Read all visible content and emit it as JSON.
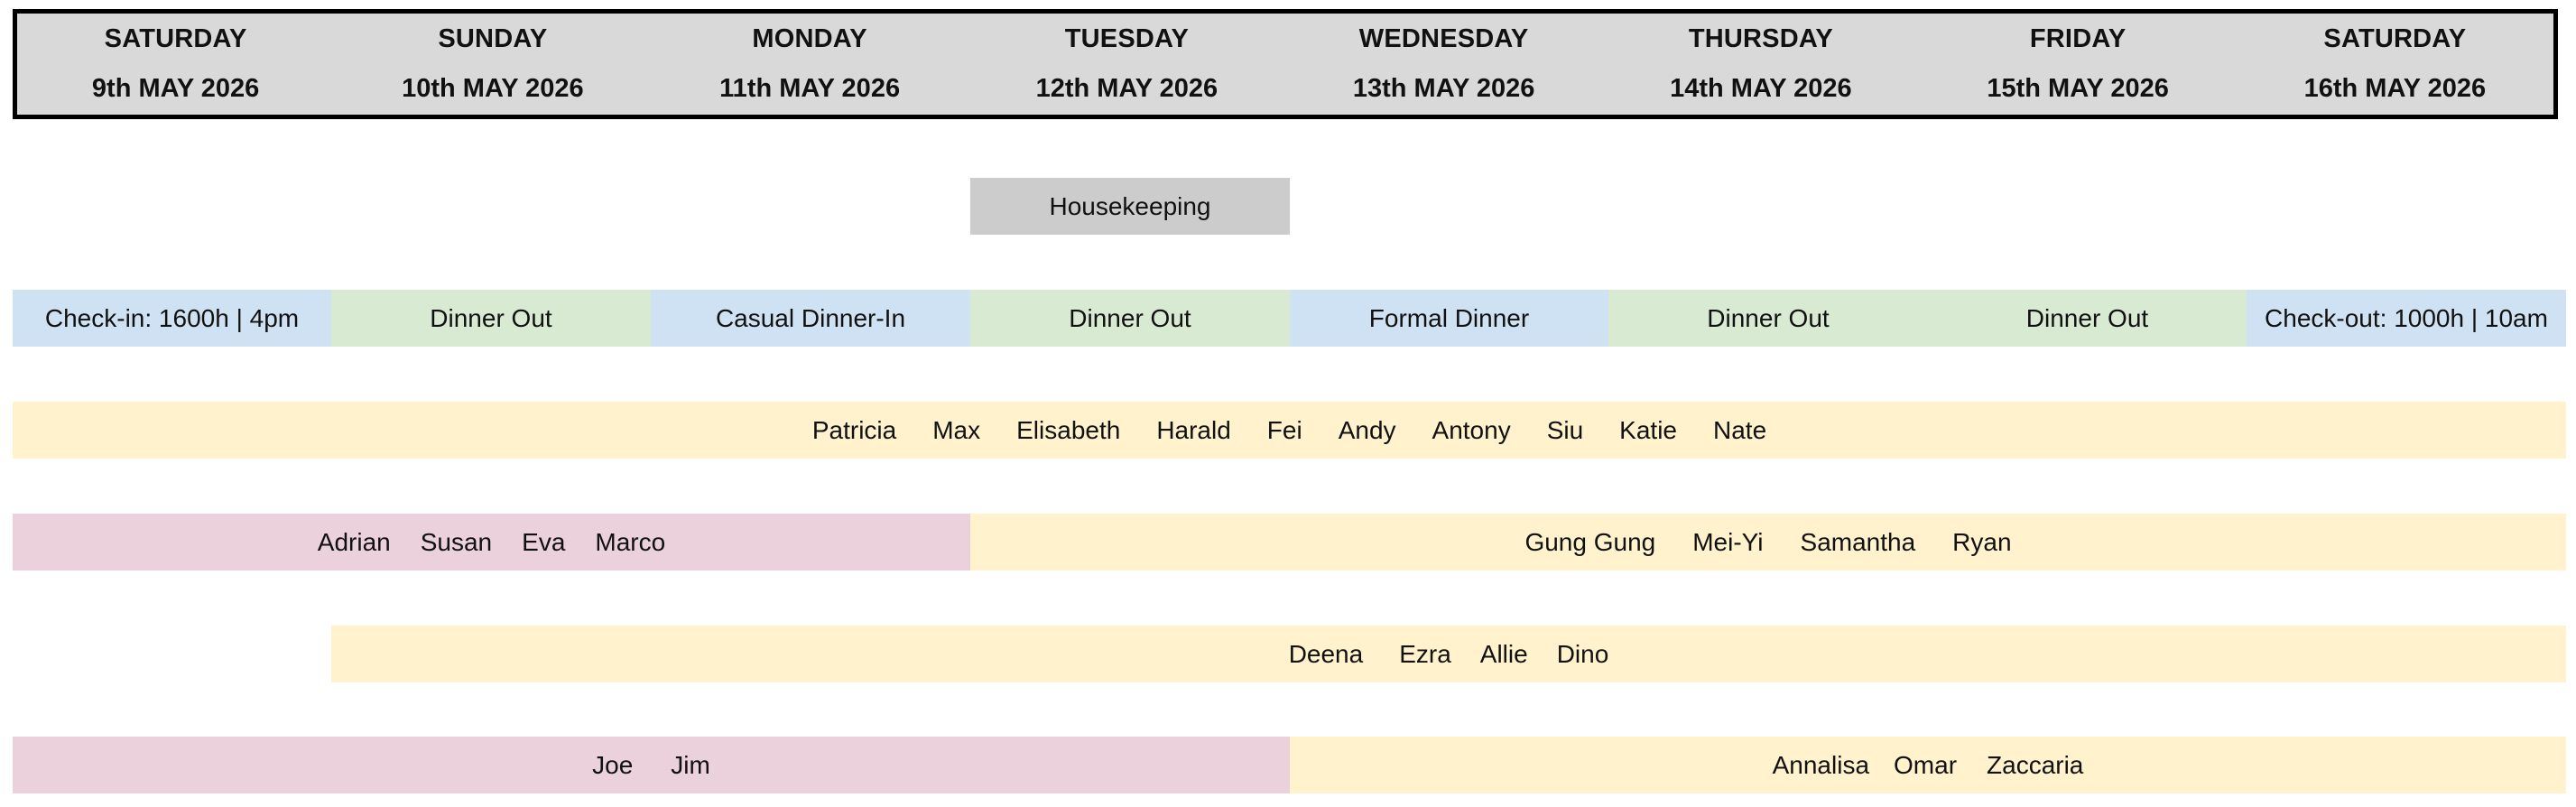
{
  "header": {
    "days": [
      {
        "name": "SATURDAY",
        "date": "9th MAY 2026"
      },
      {
        "name": "SUNDAY",
        "date": "10th MAY 2026"
      },
      {
        "name": "MONDAY",
        "date": "11th MAY 2026"
      },
      {
        "name": "TUESDAY",
        "date": "12th MAY 2026"
      },
      {
        "name": "WEDNESDAY",
        "date": "13th MAY 2026"
      },
      {
        "name": "THURSDAY",
        "date": "14th MAY 2026"
      },
      {
        "name": "FRIDAY",
        "date": "15th MAY 2026"
      },
      {
        "name": "SATURDAY",
        "date": "16th MAY 2026"
      }
    ],
    "background": "#d9d9d9",
    "border_color": "#000000"
  },
  "housekeeping": {
    "label": "Housekeeping",
    "color": "#cccccc"
  },
  "schedule": {
    "items": [
      {
        "label": "Check-in: 1600h | 4pm",
        "color": "#cfe2f3"
      },
      {
        "label": "Dinner Out",
        "color": "#d9ead3"
      },
      {
        "label": "Casual Dinner-In",
        "color": "#cfe2f3"
      },
      {
        "label": "Dinner Out",
        "color": "#d9ead3"
      },
      {
        "label": "Formal Dinner",
        "color": "#cfe2f3"
      },
      {
        "label": "Dinner Out",
        "color": "#d9ead3"
      },
      {
        "label": "Dinner Out",
        "color": "#d9ead3"
      },
      {
        "label": "Check-out: 1000h | 10am",
        "color": "#cfe2f3"
      }
    ]
  },
  "groups": {
    "group1": {
      "names": [
        "Patricia",
        "Max",
        "Elisabeth",
        "Harald",
        "Fei",
        "Andy",
        "Antony",
        "Siu",
        "Katie",
        "Nate"
      ],
      "color": "#fff2cc"
    },
    "group2a": {
      "names": [
        "Adrian",
        "Susan",
        "Eva",
        "Marco"
      ],
      "color": "#ead1dc"
    },
    "group2b": {
      "names": [
        "Gung Gung",
        "Mei-Yi",
        "Samantha",
        "Ryan"
      ],
      "color": "#fff2cc"
    },
    "group3": {
      "names": [
        "Deena",
        "Ezra",
        "Allie",
        "Dino"
      ],
      "color": "#fff2cc"
    },
    "group4a": {
      "names": [
        "Joe",
        "Jim"
      ],
      "color": "#ead1dc"
    },
    "group4b": {
      "names": [
        "Annalisa",
        "Omar",
        "Zaccaria"
      ],
      "color": "#fff2cc"
    }
  }
}
